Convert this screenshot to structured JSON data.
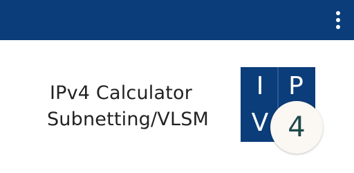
{
  "appbar": {
    "color": "#0b3d7a",
    "menu_icon": "more-vert-icon"
  },
  "title": {
    "line1": "IPv4 Calculator",
    "line2": "Subnetting/VLSM"
  },
  "logo": {
    "top_left": "I",
    "top_right": "P",
    "bottom_left": "V",
    "badge": "4",
    "tile_color": "#0b3d7a",
    "badge_color": "#fbf7f3"
  }
}
